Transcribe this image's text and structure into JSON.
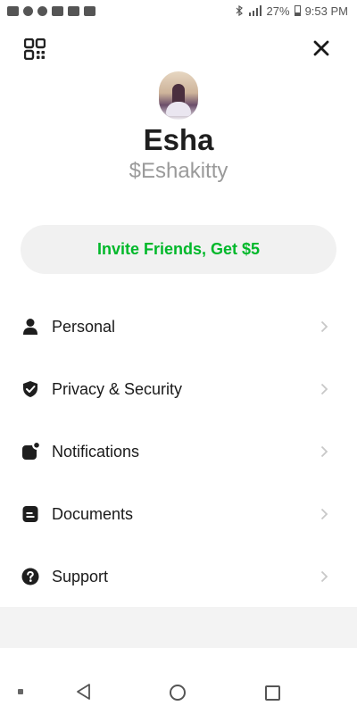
{
  "status_bar": {
    "battery": "27%",
    "time": "9:53 PM"
  },
  "profile": {
    "name": "Esha",
    "cashtag": "$Eshakitty"
  },
  "invite": {
    "label": "Invite Friends, Get $5",
    "color": "#00b82a"
  },
  "menu": [
    {
      "label": "Personal",
      "icon": "person-icon"
    },
    {
      "label": "Privacy & Security",
      "icon": "shield-check-icon"
    },
    {
      "label": "Notifications",
      "icon": "notification-badge-icon"
    },
    {
      "label": "Documents",
      "icon": "document-icon"
    },
    {
      "label": "Support",
      "icon": "help-circle-icon"
    }
  ]
}
